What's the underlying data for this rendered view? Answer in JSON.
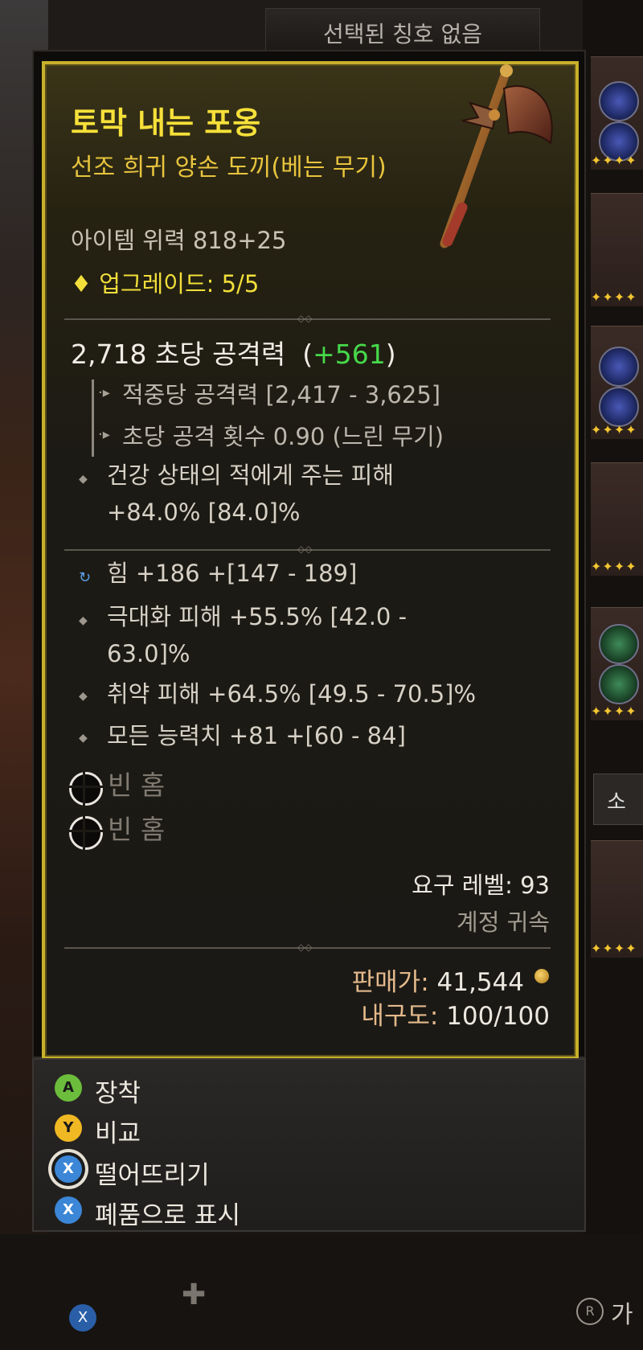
{
  "header": {
    "title_slot": "선택된 칭호 없음"
  },
  "item": {
    "name": "토막 내는 포옹",
    "type": "선조 희귀 양손 도끼(베는 무기)",
    "power": "아이템 위력 818+25",
    "upgrade": "업그레이드: 5/5",
    "dps_value": "2,718 초당 공격력",
    "dps_gain": "+561",
    "damage_per_hit": "적중당 공격력 [2,417 - 3,625]",
    "attack_speed": "초당 공격 횟수 0.90 (느린 무기)",
    "implicit": "건강 상태의 적에게 주는 피해 +84.0% [84.0]%",
    "affixes": [
      "힘 +186 +[147 - 189]",
      "극대화 피해 +55.5% [42.0 - 63.0]%",
      "취약 피해 +64.5% [49.5 - 70.5]%",
      "모든 능력치 +81 +[60 - 84]"
    ],
    "sockets": [
      "빈 홈",
      "빈 홈"
    ],
    "required_level": "요구 레벨: 93",
    "bound": "계정 귀속",
    "sell_label": "판매가:",
    "sell_value": "41,544",
    "durability_label": "내구도:",
    "durability_value": "100/100"
  },
  "actions": [
    {
      "button": "A",
      "label": "장착"
    },
    {
      "button": "Y",
      "label": "비교"
    },
    {
      "button": "X",
      "label": "떨어뜨리기"
    },
    {
      "button": "X",
      "label": "폐품으로 표시"
    }
  ],
  "right_tab": {
    "label": "소"
  },
  "bottom": {
    "x_button": "X",
    "r_button": "R",
    "r_label": "가"
  },
  "colors": {
    "legendary_name": "#f6e03a",
    "rare_type": "#e8c43e",
    "gain_green": "#46d94a",
    "frame_gold": "#c8b02a"
  }
}
